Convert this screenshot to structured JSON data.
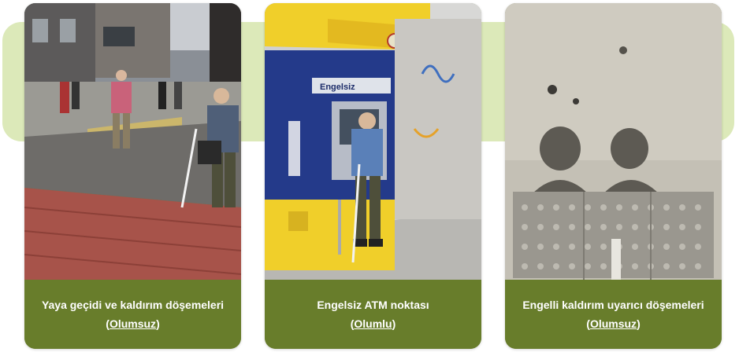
{
  "cards": [
    {
      "title": "Yaya geçidi ve kaldırım döşemeleri",
      "status": "Olumsuz",
      "photo_icon": "street-crosswalk-photo"
    },
    {
      "title": "Engelsiz ATM noktası",
      "status": "Olumlu",
      "photo_icon": "atm-photo",
      "atm_sign": "Engelsiz"
    },
    {
      "title": "Engelli kaldırım uyarıcı döşemeleri",
      "status": "Olumsuz",
      "photo_icon": "tactile-paving-photo"
    }
  ],
  "colors": {
    "caption_bg": "#687d2b",
    "band_bg": "#dce9b9",
    "caption_text": "#ffffff"
  }
}
